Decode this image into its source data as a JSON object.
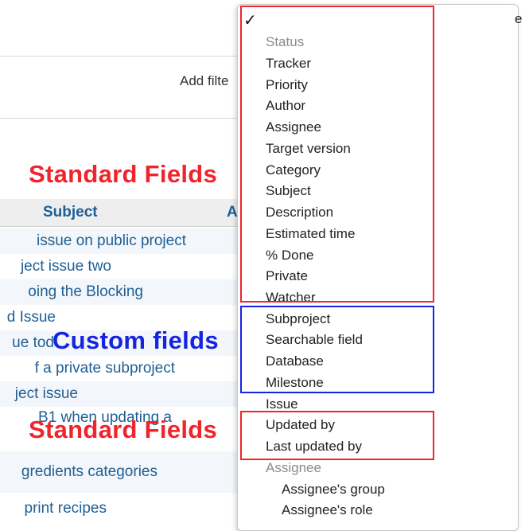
{
  "background": {
    "add_filter_label": "Add filte",
    "columns": {
      "subject": "Subject",
      "a": "A"
    },
    "rows": [
      "issue on public project",
      "ject issue two",
      "oing the Blocking",
      "d Issue",
      "ue tod",
      "f a private subproject",
      "ject issue",
      "B1 when updating a",
      "gredients categories",
      "print recipes"
    ],
    "edge_letter": "e"
  },
  "annotations": {
    "standard_fields_top": "Standard Fields",
    "custom_fields": "Custom fields",
    "standard_fields_bottom": "Standard Fields"
  },
  "menu": {
    "checkmark": "✓",
    "items": [
      {
        "label": "Status",
        "style": "gray"
      },
      {
        "label": "Tracker"
      },
      {
        "label": "Priority"
      },
      {
        "label": "Author"
      },
      {
        "label": "Assignee"
      },
      {
        "label": "Target version"
      },
      {
        "label": "Category"
      },
      {
        "label": "Subject"
      },
      {
        "label": "Description"
      },
      {
        "label": "Estimated time"
      },
      {
        "label": "% Done"
      },
      {
        "label": "Private"
      },
      {
        "label": "Watcher"
      },
      {
        "label": "Subproject"
      },
      {
        "label": "Searchable field"
      },
      {
        "label": "Database"
      },
      {
        "label": "Milestone"
      },
      {
        "label": "Issue"
      },
      {
        "label": "Updated by"
      },
      {
        "label": "Last updated by"
      },
      {
        "label": "Assignee",
        "style": "gray"
      },
      {
        "label": "Assignee's group",
        "style": "sub"
      },
      {
        "label": "Assignee's role",
        "style": "sub"
      }
    ]
  },
  "colors": {
    "standard_highlight": "#f0242c",
    "custom_highlight": "#1524e0",
    "link": "#1f5f94"
  }
}
